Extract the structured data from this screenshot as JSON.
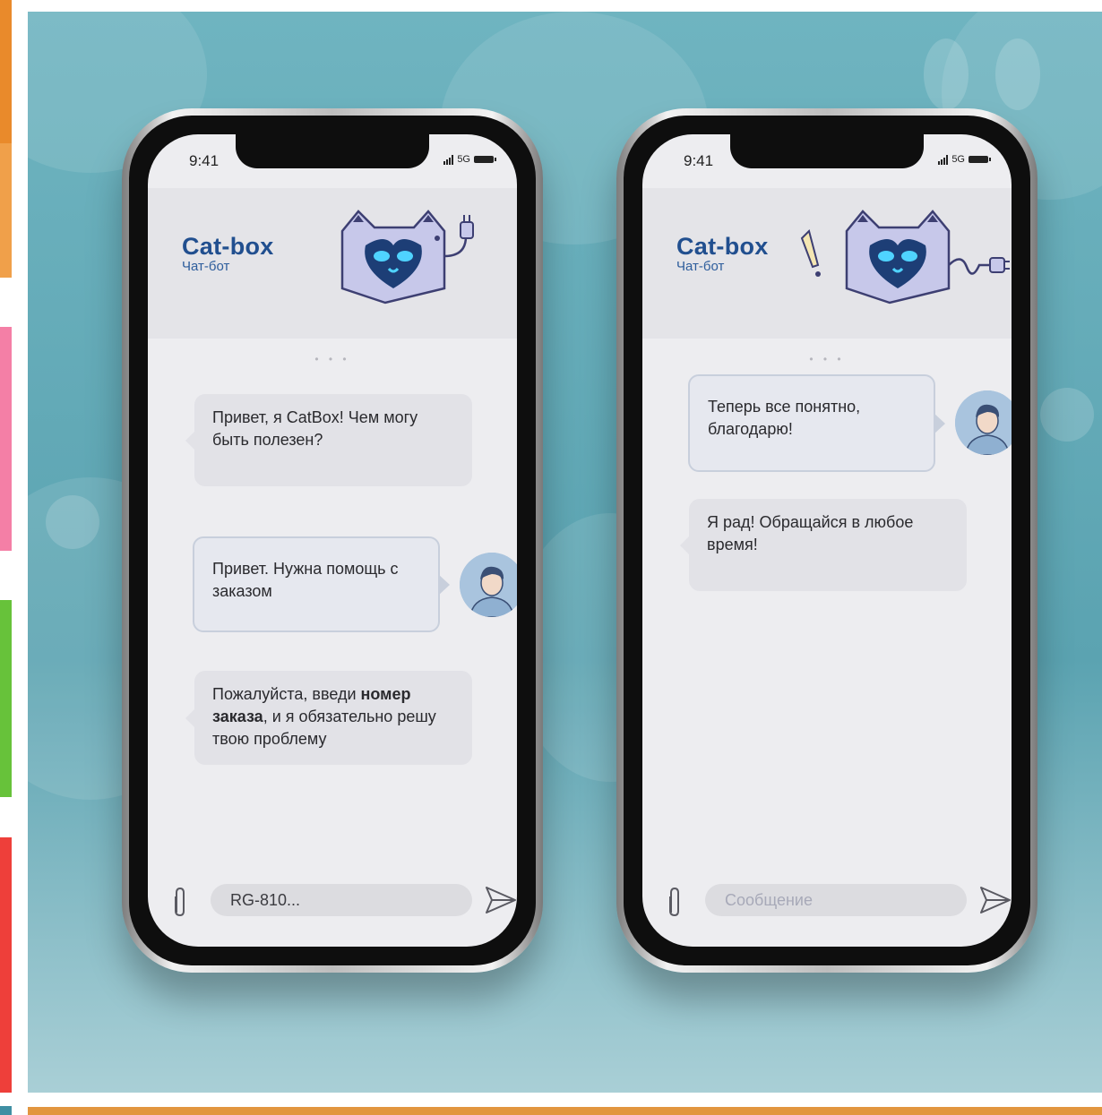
{
  "colors": {
    "accent": "#214f8f",
    "background": "#5ba3b1",
    "bubble": "#e2e2e7",
    "user_border": "#c8cfdc"
  },
  "phones": [
    {
      "status": {
        "time": "9:41",
        "network": "5G"
      },
      "header": {
        "title": "Cat-box",
        "subtitle": "Чат-бот"
      },
      "typing_indicator": "• • •",
      "messages": [
        {
          "from": "bot",
          "text": "Привет, я CatBox! Чем могу быть полезен?"
        },
        {
          "from": "user",
          "text": "Привет. Нужна помощь с заказом"
        },
        {
          "from": "bot",
          "text_pre": "Пожалуйста, введи ",
          "text_bold_1": "номер заказа",
          "text_post": ", и я обязательно решу твою проблему"
        }
      ],
      "composer": {
        "value": "RG-810...",
        "icons": [
          "paperclip-icon",
          "send-icon"
        ]
      }
    },
    {
      "status": {
        "time": "9:41",
        "network": "5G"
      },
      "header": {
        "title": "Cat-box",
        "subtitle": "Чат-бот"
      },
      "typing_indicator": "• • •",
      "messages": [
        {
          "from": "user",
          "text": "Теперь все понятно, благодарю!"
        },
        {
          "from": "bot",
          "text": "Я рад! Обращайся в любое время!"
        }
      ],
      "composer": {
        "placeholder": "Сообщение",
        "icons": [
          "paperclip-icon",
          "send-icon"
        ]
      }
    }
  ]
}
